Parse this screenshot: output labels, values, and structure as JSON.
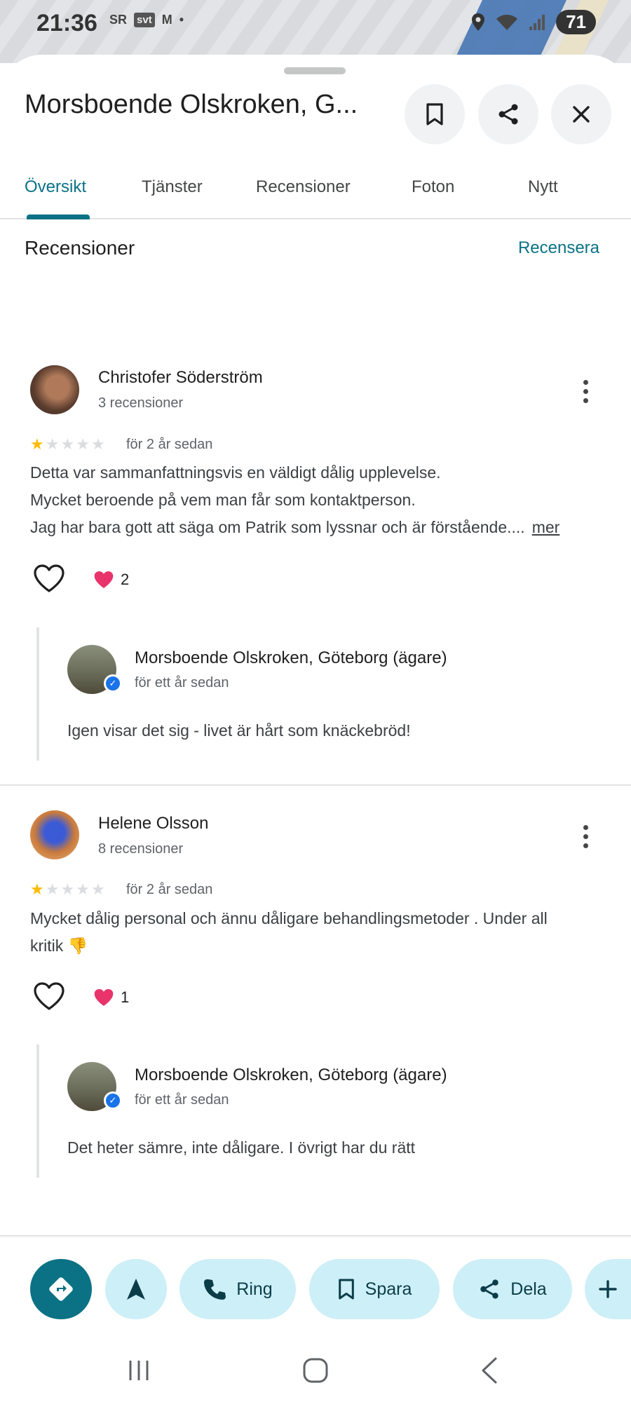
{
  "status": {
    "time": "21:36",
    "icons": [
      "SR",
      "svt",
      "M",
      "•"
    ],
    "battery": "71"
  },
  "header": {
    "title": "Morsboende Olskroken, G...",
    "save_icon": "bookmark-icon",
    "share_icon": "share-icon",
    "close_icon": "close-icon"
  },
  "tabs": [
    {
      "label": "Översikt",
      "active": true
    },
    {
      "label": "Tjänster"
    },
    {
      "label": "Recensioner"
    },
    {
      "label": "Foton"
    },
    {
      "label": "Nytt"
    }
  ],
  "reviews_section": {
    "title": "Recensioner",
    "write_review": "Recensera"
  },
  "reviews": [
    {
      "name": "Christofer Söderström",
      "count": "3 recensioner",
      "rating": 1,
      "time": "för 2 år sedan",
      "lines": [
        "Detta var sammanfattningsvis en väldigt dålig upplevelse.",
        "Mycket beroende på vem man får som kontaktperson.",
        "Jag har bara gott att säga om Patrik som lyssnar och är förstående...."
      ],
      "more": "mer",
      "likes": "2",
      "reply": {
        "owner": "Morsboende Olskroken, Göteborg (ägare)",
        "time": "för ett år sedan",
        "text": "Igen visar det sig - livet är hårt som knäckebröd!"
      }
    },
    {
      "name": "Helene Olsson",
      "count": "8 recensioner",
      "rating": 1,
      "time": "för 2 år sedan",
      "lines": [
        "Mycket dålig personal och ännu dåligare behandlingsmetoder . Under all",
        "kritik 👎"
      ],
      "likes": "1",
      "reply": {
        "owner": "Morsboende Olskroken, Göteborg (ägare)",
        "time": "för ett år sedan",
        "text": "Det heter sämre, inte dåligare. I övrigt har du rätt"
      }
    }
  ],
  "actions": {
    "directions_icon": "directions-icon",
    "start_icon": "navigation-arrow-icon",
    "call": "Ring",
    "save": "Spara",
    "share": "Dela",
    "more_icon": "plus-icon"
  },
  "colors": {
    "accent": "#0b7285",
    "chip": "#cdeff7",
    "star": "#fbbc04",
    "verified": "#1a73e8"
  }
}
